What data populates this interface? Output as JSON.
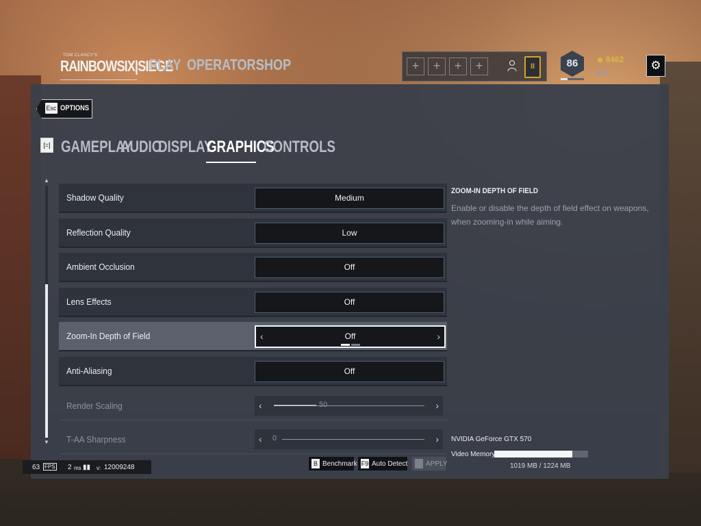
{
  "header": {
    "logo_small": "TOM CLANCY'S",
    "logo_text": "RAINBOWSIX|SIEGE",
    "nav": [
      "PLAY",
      "OPERATORS",
      "SHOP"
    ],
    "squad_slot_glyph": "+",
    "rank_badge": "II",
    "level": "86",
    "renown": "8462",
    "credits": "0",
    "settings_icon": "gear-icon"
  },
  "back": {
    "key": "Esc",
    "label": "OPTIONS"
  },
  "tabs": {
    "icon_label": "[=]",
    "items": [
      "GAMEPLAY",
      "AUDIO",
      "DISPLAY",
      "GRAPHICS",
      "CONTROLS"
    ],
    "active": "GRAPHICS"
  },
  "settings": [
    {
      "label": "Shadow Quality",
      "value": "Medium"
    },
    {
      "label": "Reflection Quality",
      "value": "Low"
    },
    {
      "label": "Ambient Occlusion",
      "value": "Off"
    },
    {
      "label": "Lens Effects",
      "value": "Off"
    },
    {
      "label": "Zoom-In Depth of Field",
      "value": "Off"
    },
    {
      "label": "Anti-Aliasing",
      "value": "Off"
    },
    {
      "label": "Render Scaling",
      "value": "50",
      "level": 0.28
    },
    {
      "label": "T-AA Sharpness",
      "value": "0",
      "level": 0.0
    }
  ],
  "help": {
    "title": "ZOOM-IN DEPTH OF FIELD",
    "text": "Enable or disable the depth of field effect on weapons, when zooming-in while aiming."
  },
  "gpu": {
    "name": "NVIDIA GeForce GTX 570",
    "vram_label": "Video Memory:",
    "vram_text": "1019 MB / 1224 MB",
    "vram_used_fraction": 0.832
  },
  "footer_buttons": {
    "benchmark_key": "B",
    "benchmark": "Benchmark",
    "autodetect_key": "F9",
    "autodetect": "Auto Detect",
    "apply_key": "",
    "apply": "APPLY"
  },
  "perf": {
    "fps": "63",
    "fps_unit": "FPS",
    "ping": "2",
    "ping_unit": "ms",
    "version_prefix": "v:",
    "version": "12009248"
  }
}
